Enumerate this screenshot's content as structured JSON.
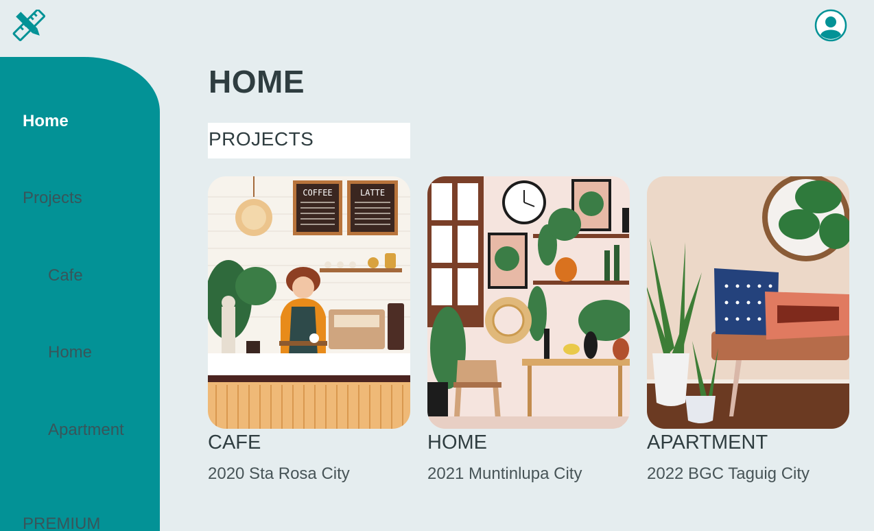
{
  "app": {
    "logo_icon": "pencil-ruler-icon",
    "profile_icon": "user-avatar-icon"
  },
  "colors": {
    "accent": "#039296",
    "background": "#e5edef",
    "active_nav": "#ffffff",
    "nav_text": "#38555a"
  },
  "sidebar": {
    "items": [
      {
        "label": "Home",
        "active": true
      },
      {
        "label": "Projects"
      },
      {
        "label": "Cafe"
      },
      {
        "label": "Home"
      },
      {
        "label": "Apartment"
      },
      {
        "label": "PREMIUM"
      }
    ]
  },
  "main": {
    "title": "HOME",
    "section_title": "PROJECTS",
    "cards": [
      {
        "name": "CAFE",
        "subtitle": "2020 Sta Rosa City",
        "image": "cafe-illustration"
      },
      {
        "name": "HOME",
        "subtitle": "2021 Muntinlupa City",
        "image": "home-illustration"
      },
      {
        "name": "APARTMENT",
        "subtitle": "2022 BGC Taguig City",
        "image": "apartment-illustration"
      }
    ],
    "cafe_menu": {
      "coffee": "COFFEE",
      "latte": "LATTE"
    }
  }
}
